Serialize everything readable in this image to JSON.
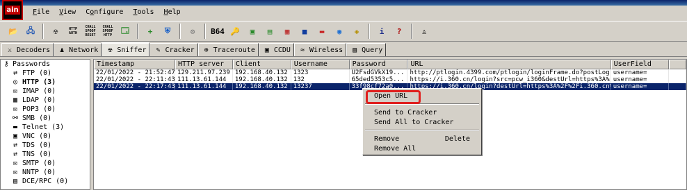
{
  "app": {
    "icon_text": "ain"
  },
  "menu": [
    {
      "label": "File",
      "mnemonic": "F"
    },
    {
      "label": "View",
      "mnemonic": "V"
    },
    {
      "label": "Configure",
      "mnemonic": "o"
    },
    {
      "label": "Tools",
      "mnemonic": "T"
    },
    {
      "label": "Help",
      "mnemonic": "H"
    }
  ],
  "toolbar": {
    "buttons": [
      {
        "name": "open-folder-icon",
        "glyph": "📂"
      },
      {
        "name": "network-adapter-icon",
        "glyph": "🖧"
      },
      {
        "name": "radiation-icon",
        "glyph": "☢"
      },
      {
        "name": "http-auth-icon",
        "glyph": "HTTP AUTH"
      },
      {
        "name": "chall-spoof-reset-icon",
        "glyph": "CHALL SPOOF RESET"
      },
      {
        "name": "chall-spoof-http-icon",
        "glyph": "CHALL SPOOF HTTP"
      },
      {
        "name": "certificate-icon",
        "glyph": "🗔"
      },
      {
        "name": "add-icon",
        "glyph": "+"
      },
      {
        "name": "shield-icon",
        "glyph": "⛨"
      },
      {
        "name": "run-icon",
        "glyph": "⚙"
      },
      {
        "name": "base64-icon",
        "glyph": "B64"
      },
      {
        "name": "rsa-icon",
        "glyph": "🔑"
      },
      {
        "name": "terminal-icon",
        "glyph": "▣"
      },
      {
        "name": "netbios-icon",
        "glyph": "▤"
      },
      {
        "name": "traceroute-icon",
        "glyph": "▦"
      },
      {
        "name": "monitor-icon",
        "glyph": "■"
      },
      {
        "name": "database-icon",
        "glyph": "▬"
      },
      {
        "name": "wireless-icon",
        "glyph": "◉"
      },
      {
        "name": "capture-icon",
        "glyph": "◈"
      },
      {
        "name": "info-icon",
        "glyph": "i"
      },
      {
        "name": "help-icon",
        "glyph": "?"
      },
      {
        "name": "user-icon",
        "glyph": "♙"
      }
    ]
  },
  "tabs": [
    {
      "label": "Decoders",
      "icon": "decoder-icon",
      "glyph": "⚔"
    },
    {
      "label": "Network",
      "icon": "network-icon",
      "glyph": "♟"
    },
    {
      "label": "Sniffer",
      "icon": "sniffer-icon",
      "glyph": "☢"
    },
    {
      "label": "Cracker",
      "icon": "cracker-icon",
      "glyph": "✎"
    },
    {
      "label": "Traceroute",
      "icon": "traceroute-icon",
      "glyph": "⊕"
    },
    {
      "label": "CCDU",
      "icon": "ccdu-icon",
      "glyph": "▣"
    },
    {
      "label": "Wireless",
      "icon": "wireless-icon",
      "glyph": "≈"
    },
    {
      "label": "Query",
      "icon": "query-icon",
      "glyph": "▤"
    }
  ],
  "active_tab": "Sniffer",
  "tree": {
    "root": "Passwords",
    "items": [
      {
        "label": "FTP (0)",
        "icon": "ftp-icon",
        "glyph": "⇄"
      },
      {
        "label": "HTTP (3)",
        "icon": "http-icon",
        "glyph": "◎",
        "selected": true
      },
      {
        "label": "IMAP (0)",
        "icon": "imap-icon",
        "glyph": "✉"
      },
      {
        "label": "LDAP (0)",
        "icon": "ldap-icon",
        "glyph": "▦"
      },
      {
        "label": "POP3 (0)",
        "icon": "pop3-icon",
        "glyph": "✉"
      },
      {
        "label": "SMB (0)",
        "icon": "smb-icon",
        "glyph": "⚯"
      },
      {
        "label": "Telnet (3)",
        "icon": "telnet-icon",
        "glyph": "▬"
      },
      {
        "label": "VNC (0)",
        "icon": "vnc-icon",
        "glyph": "▣"
      },
      {
        "label": "TDS (0)",
        "icon": "tds-icon",
        "glyph": "⇄"
      },
      {
        "label": "TNS (0)",
        "icon": "tns-icon",
        "glyph": "⇄"
      },
      {
        "label": "SMTP (0)",
        "icon": "smtp-icon",
        "glyph": "✉"
      },
      {
        "label": "NNTP (0)",
        "icon": "nntp-icon",
        "glyph": "✉"
      },
      {
        "label": "DCE/RPC (0)",
        "icon": "dcerpc-icon",
        "glyph": "▤"
      }
    ]
  },
  "table": {
    "columns": [
      "Timestamp",
      "HTTP server",
      "Client",
      "Username",
      "Password",
      "URL",
      "UserField",
      ""
    ],
    "rows": [
      [
        "22/01/2022 - 21:52:47",
        "129.211.97.239",
        "192.168.40.132",
        "1323",
        "U2FsdGVkX19...",
        "http://ptlogin.4399.com/ptlogin/loginFrame.do?postLog...",
        "username=",
        ""
      ],
      [
        "22/01/2022 - 22:11:43",
        "111.13.61.144",
        "192.168.40.132",
        "132",
        "65ded5353c5...",
        "https://i.360.cn/login?src=pcw_i360&destUrl=https%3A%...",
        "username=",
        ""
      ],
      [
        "22/01/2022 - 22:17:43",
        "111.13.61.144",
        "192.168.40.132",
        "13237",
        "33f98cf72a0...",
        "https://i.360.cn/login?destUrl=https%3A%2F%2Fi.360.cn%2F",
        "username=",
        ""
      ]
    ],
    "selected_row": 2
  },
  "context_menu": {
    "items": [
      {
        "label": "Open URL",
        "shortcut": "",
        "highlighted": true
      },
      {
        "label": "Send to Cracker",
        "shortcut": ""
      },
      {
        "label": "Send All to Cracker",
        "shortcut": ""
      },
      {
        "label": "Remove",
        "shortcut": "Delete"
      },
      {
        "label": "Remove All",
        "shortcut": ""
      }
    ]
  },
  "colors": {
    "highlight_box": "#e0201e",
    "selection": "#0a246a"
  }
}
